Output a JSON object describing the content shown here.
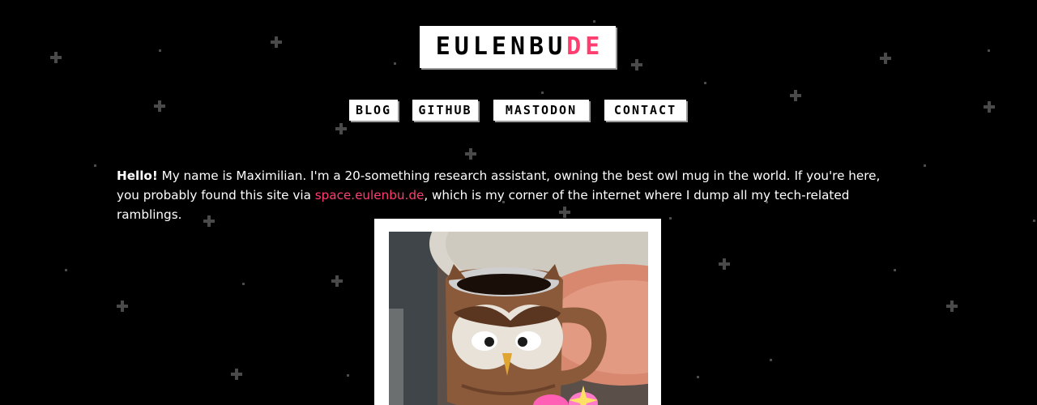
{
  "header": {
    "logo_main": "EULENBU",
    "logo_accent": "DE"
  },
  "nav": {
    "items": [
      {
        "label": "BLOG"
      },
      {
        "label": "GITHUB"
      },
      {
        "label": "MASTODON"
      },
      {
        "label": "CONTACT"
      }
    ]
  },
  "intro": {
    "greeting": "Hello!",
    "text_1": " My name is Maximilian. I'm a 20-something research assistant, owning the best owl mug in the world. If you're here, you probably found this site via ",
    "link_text": "space.eulenbu.de",
    "text_2": ", which is my corner of the internet where I dump all my tech-related ramblings."
  },
  "colors": {
    "background": "#000000",
    "accent": "#ff3d6e",
    "button_bg": "#ffffff"
  },
  "photo": {
    "icon": "owl-mug-photo"
  }
}
